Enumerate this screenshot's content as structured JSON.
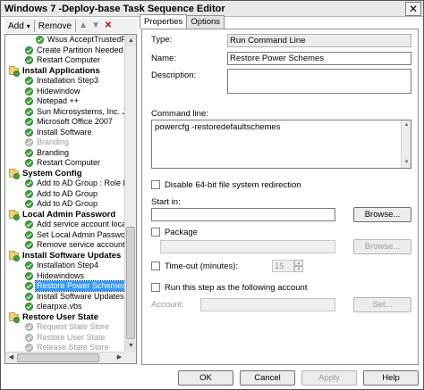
{
  "window": {
    "title": "Windows 7 -Deploy-base Task Sequence Editor",
    "close_glyph": "✕"
  },
  "toolbar": {
    "add_label": "Add",
    "add_arrow": "▾",
    "remove_label": "Remove"
  },
  "tree": [
    {
      "type": "step",
      "label": "Wsus AcceptTrustedPu",
      "level": 2,
      "status": "ok"
    },
    {
      "type": "step",
      "label": "Create Partition Needed by",
      "level": 1,
      "status": "ok"
    },
    {
      "type": "step",
      "label": "Restart Computer",
      "level": 1,
      "status": "ok"
    },
    {
      "type": "group",
      "label": "Install Applications"
    },
    {
      "type": "step",
      "label": "Installation Step3",
      "level": 1,
      "status": "ok"
    },
    {
      "type": "step",
      "label": "Hidewindow",
      "level": 1,
      "status": "ok"
    },
    {
      "type": "step",
      "label": "Notepad ++",
      "level": 1,
      "status": "ok"
    },
    {
      "type": "step",
      "label": "Sun Microsystems, Inc. Java",
      "level": 1,
      "status": "ok"
    },
    {
      "type": "step",
      "label": "Microsoft Office 2007",
      "level": 1,
      "status": "ok"
    },
    {
      "type": "step",
      "label": "Install Software",
      "level": 1,
      "status": "ok"
    },
    {
      "type": "step",
      "label": "Branding",
      "level": 1,
      "status": "disabled"
    },
    {
      "type": "step",
      "label": "Branding",
      "level": 1,
      "status": "ok"
    },
    {
      "type": "step",
      "label": "Restart Computer",
      "level": 1,
      "status": "ok"
    },
    {
      "type": "group",
      "label": "System Config"
    },
    {
      "type": "step",
      "label": "Add to AD Group : Role HR",
      "level": 1,
      "status": "ok"
    },
    {
      "type": "step",
      "label": "Add to AD Group",
      "level": 1,
      "status": "ok"
    },
    {
      "type": "step",
      "label": "Add to AD Group",
      "level": 1,
      "status": "ok"
    },
    {
      "type": "group",
      "label": "Local Admin Password"
    },
    {
      "type": "step",
      "label": "Add service account local ac",
      "level": 1,
      "status": "ok"
    },
    {
      "type": "step",
      "label": "Set Local Admin Password",
      "level": 1,
      "status": "ok"
    },
    {
      "type": "step",
      "label": "Remove service account loca",
      "level": 1,
      "status": "ok"
    },
    {
      "type": "group",
      "label": "Install Software Updates"
    },
    {
      "type": "step",
      "label": "Installation Step4",
      "level": 1,
      "status": "ok"
    },
    {
      "type": "step",
      "label": "Hidewindows",
      "level": 1,
      "status": "ok"
    },
    {
      "type": "step",
      "label": "Restore Power Schemes",
      "level": 1,
      "status": "ok",
      "selected": true
    },
    {
      "type": "step",
      "label": "Install Software Updates",
      "level": 1,
      "status": "ok"
    },
    {
      "type": "step",
      "label": "clearpxe.vbs",
      "level": 1,
      "status": "ok"
    },
    {
      "type": "group",
      "label": "Restore User State"
    },
    {
      "type": "step",
      "label": "Request State Store",
      "level": 1,
      "status": "disabled"
    },
    {
      "type": "step",
      "label": "Restore User State",
      "level": 1,
      "status": "disabled"
    },
    {
      "type": "step",
      "label": "Release State Store",
      "level": 1,
      "status": "disabled"
    }
  ],
  "tabs": [
    {
      "label": "Properties",
      "active": true
    },
    {
      "label": "Options",
      "active": false
    }
  ],
  "properties": {
    "type_label": "Type:",
    "type_value": "Run Command Line",
    "name_label": "Name:",
    "name_value": "Restore Power Schemes",
    "description_label": "Description:",
    "description_value": "",
    "command_label": "Command line:",
    "command_value": "powercfg -restoredefaultschemes",
    "disable64_label": "Disable 64-bit file system redirection",
    "startin_label": "Start in:",
    "startin_value": "",
    "browse_label": "Browse...",
    "package_label": "Package",
    "package_value": "",
    "browse2_label": "Browse...",
    "timeout_label": "Time-out (minutes):",
    "timeout_value": "15",
    "runas_label": "Run this step as the following account",
    "account_label": "Account:",
    "account_value": "",
    "set_label": "Set..."
  },
  "buttons": {
    "ok": "OK",
    "cancel": "Cancel",
    "apply": "Apply",
    "help": "Help"
  }
}
